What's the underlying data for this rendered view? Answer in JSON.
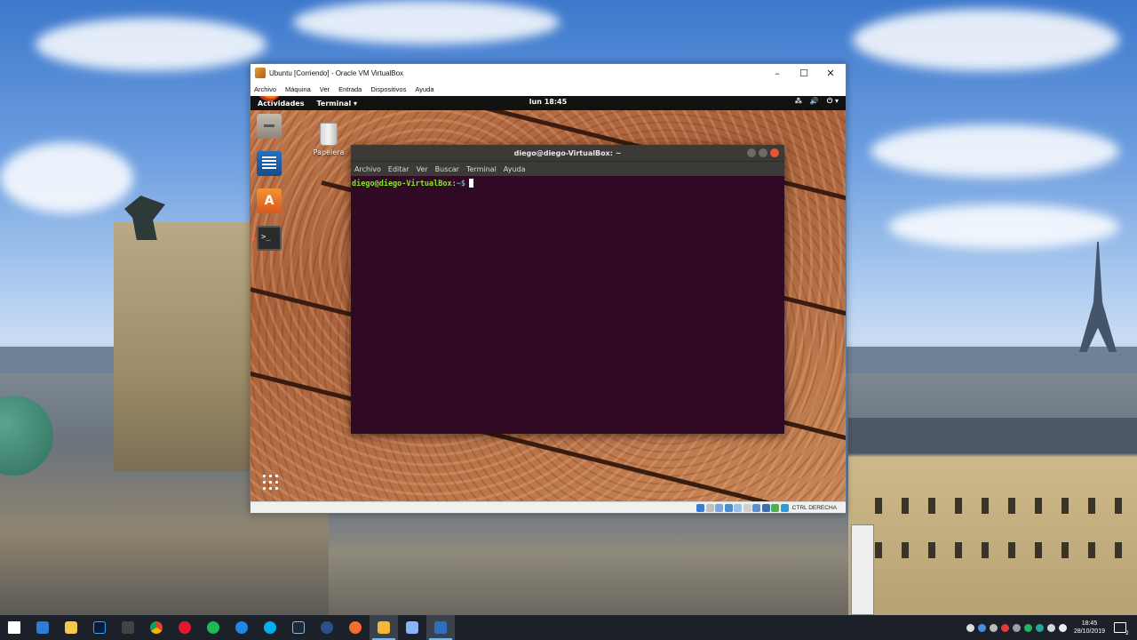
{
  "vbox": {
    "title": "Ubuntu [Corriendo] - Oracle VM VirtualBox",
    "menu": [
      "Archivo",
      "Máquina",
      "Ver",
      "Entrada",
      "Dispositivos",
      "Ayuda"
    ],
    "controls": {
      "minimize": "–",
      "maximize": "☐",
      "close": "✕"
    },
    "status_hostkey": "CTRL DERECHA"
  },
  "ubuntu": {
    "activities": "Actividades",
    "app_menu": "Terminal ▾",
    "clock": "lun 18:45",
    "tray": {
      "network": "⁂",
      "volume": "🔊",
      "power": "⏻ ▾"
    },
    "desktop_icon_label": "Papelera",
    "dock_software_glyph": "A",
    "dock_terminal_glyph": ">_"
  },
  "terminal": {
    "title": "diego@diego-VirtualBox: ~",
    "menu": [
      "Archivo",
      "Editar",
      "Ver",
      "Buscar",
      "Terminal",
      "Ayuda"
    ],
    "prompt_user": "diego@diego-VirtualBox",
    "prompt_sep": ":",
    "prompt_path": "~$"
  },
  "taskbar": {
    "time": "18:45",
    "date": "28/10/2019"
  },
  "colors": {
    "terminal_bg": "#300a24",
    "prompt_green": "#8ae234",
    "prompt_blue": "#729fcf",
    "taskbar_bg": "#1c2129"
  }
}
